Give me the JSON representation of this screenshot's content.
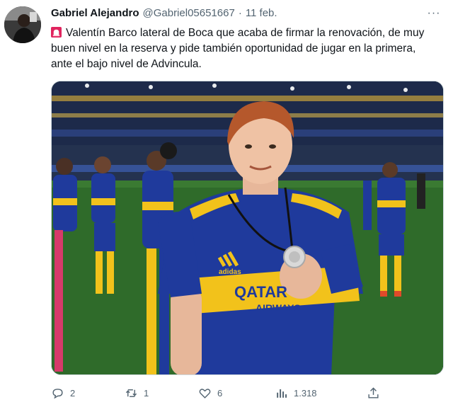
{
  "tweet": {
    "author_name": "Gabriel Alejandro",
    "author_handle": "@Gabriel05651667",
    "separator": "·",
    "date": "11 feb.",
    "more_glyph": "···",
    "text": "Valentín Barco lateral de Boca que acaba de firmar la renovación, de muy buen nivel en la reserva y pide también oportunidad de jugar en la primera, ante el bajo nivel de Advincula.",
    "leading_emoji": "siren-icon",
    "media": {
      "kit_text_line1": "QATAR",
      "kit_text_line2": "AIRWAYS",
      "kit_brand": "adidas",
      "colors": {
        "kit_blue": "#1f3a9c",
        "kit_yellow": "#f2c21b",
        "pitch": "#2f6b2a",
        "hair": "#b5582c"
      }
    },
    "actions": {
      "replies": "2",
      "retweets": "1",
      "likes": "6",
      "views": "1.318"
    }
  }
}
